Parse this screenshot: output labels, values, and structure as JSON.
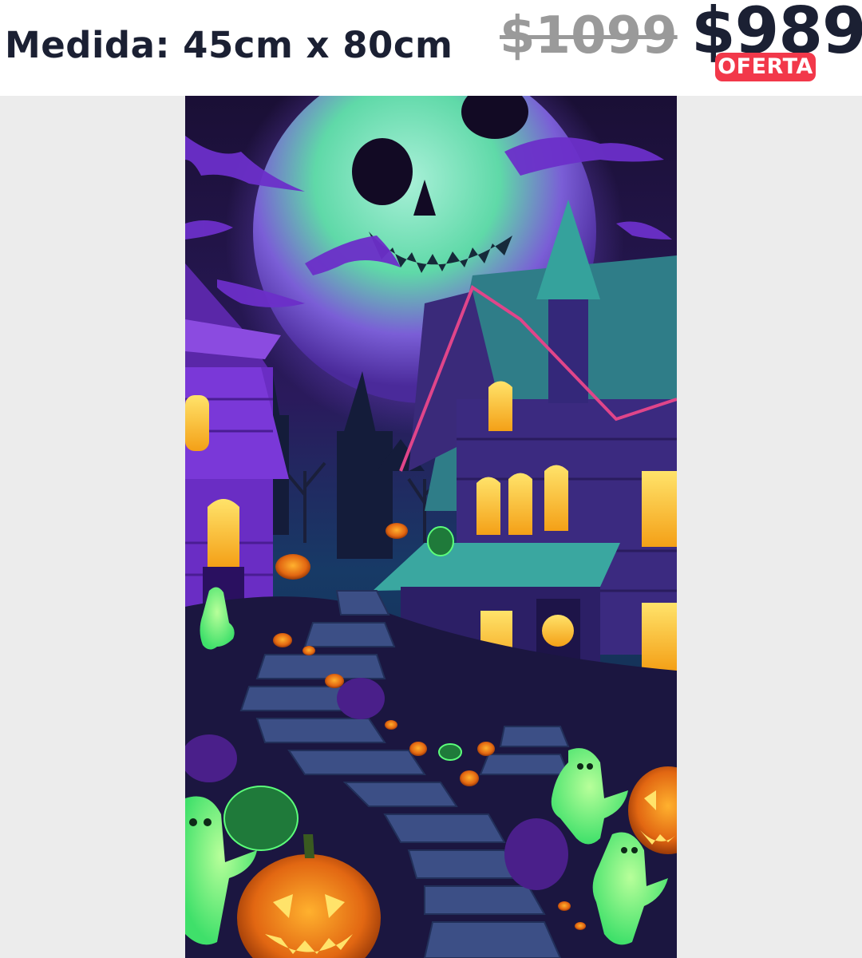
{
  "header": {
    "measure_label": "Medida: 45cm x 80cm",
    "old_price": "$1099",
    "new_price": "$989",
    "offer_badge": "OFERTA"
  },
  "colors": {
    "text_dark": "#1b2033",
    "old_price_gray": "#9a9a9a",
    "badge_red": "#f2384a",
    "page_background": "#ececec"
  },
  "poster": {
    "subject": "Halloween haunted village poster with skull moon, bats, purple houses, green ghosts and jack-o'-lanterns"
  }
}
